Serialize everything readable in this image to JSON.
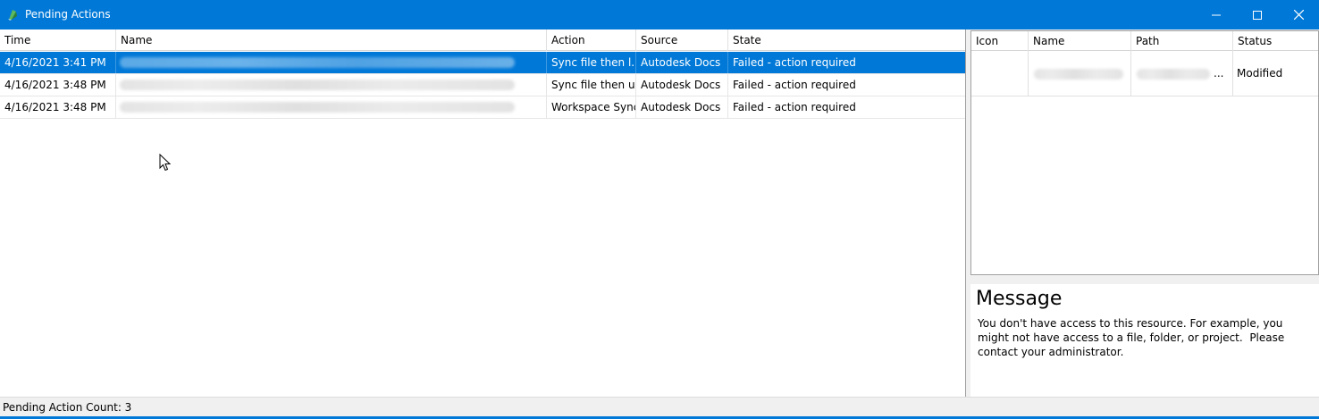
{
  "window": {
    "title": "Pending Actions",
    "accent_color": "#0078d7",
    "controls": [
      "minimize-icon",
      "maximize-icon",
      "close-icon"
    ]
  },
  "actions_grid": {
    "columns": [
      "Time",
      "Name",
      "Action",
      "Source",
      "State"
    ],
    "rows": [
      {
        "time": "4/16/2021 3:41 PM",
        "name": "",
        "action": "Sync file then l...",
        "source": "Autodesk Docs",
        "state": "Failed - action required",
        "selected": true
      },
      {
        "time": "4/16/2021 3:48 PM",
        "name": "",
        "action": "Sync file then u...",
        "source": "Autodesk Docs",
        "state": "Failed - action required",
        "selected": false
      },
      {
        "time": "4/16/2021 3:48 PM",
        "name": "",
        "action": "Workspace Sync",
        "source": "Autodesk Docs",
        "state": "Failed - action required",
        "selected": false
      }
    ]
  },
  "details_grid": {
    "columns": [
      "Icon",
      "Name",
      "Path",
      "Status"
    ],
    "rows": [
      {
        "icon": "",
        "name": "",
        "path": "...",
        "status": "Modified"
      }
    ]
  },
  "message": {
    "title": "Message",
    "body": "You don't have access to this resource. For example, you might not have access to a file, folder, or project.  Please contact your administrator."
  },
  "statusbar": {
    "text": "Pending Action Count: 3"
  }
}
